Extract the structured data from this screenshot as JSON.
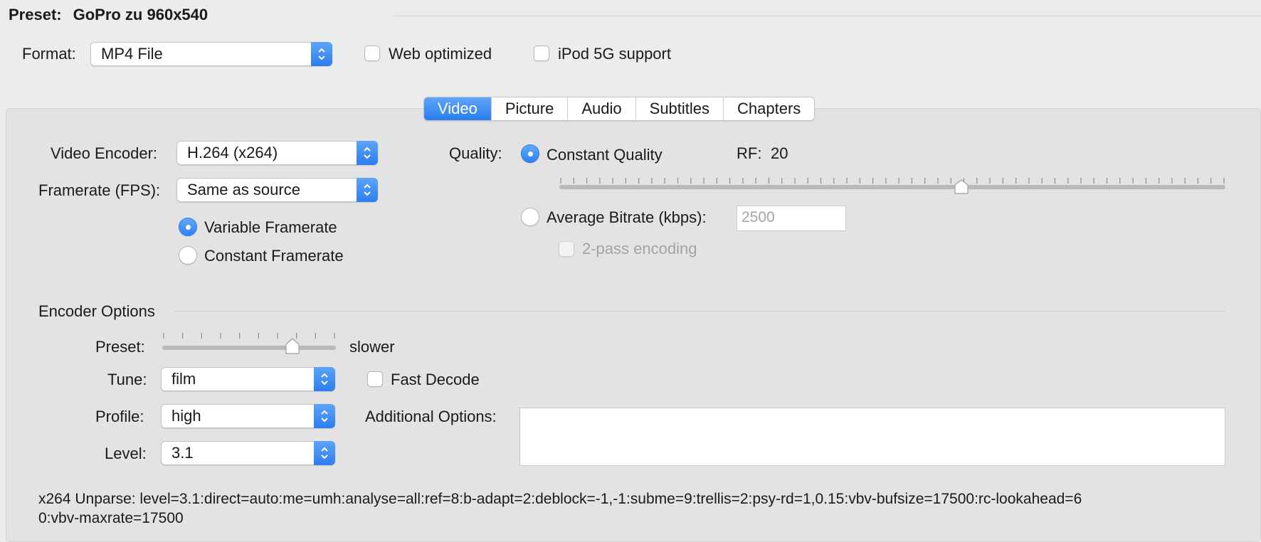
{
  "preset": {
    "label": "Preset:",
    "name": "GoPro zu 960x540"
  },
  "format": {
    "label": "Format:",
    "value": "MP4 File",
    "web_optimized_label": "Web optimized",
    "web_optimized_checked": false,
    "ipod_label": "iPod 5G support",
    "ipod_checked": false
  },
  "tabs": [
    {
      "label": "Video",
      "active": true
    },
    {
      "label": "Picture",
      "active": false
    },
    {
      "label": "Audio",
      "active": false
    },
    {
      "label": "Subtitles",
      "active": false
    },
    {
      "label": "Chapters",
      "active": false
    }
  ],
  "video": {
    "encoder_label": "Video Encoder:",
    "encoder_value": "H.264 (x264)",
    "framerate_label": "Framerate (FPS):",
    "framerate_value": "Same as source",
    "variable_framerate_label": "Variable Framerate",
    "constant_framerate_label": "Constant Framerate",
    "framerate_mode": "variable"
  },
  "quality": {
    "label": "Quality:",
    "constant_quality_label": "Constant Quality",
    "rf_label": "RF:",
    "rf_value": "20",
    "average_bitrate_label": "Average Bitrate (kbps):",
    "bitrate_value": "2500",
    "two_pass_label": "2-pass encoding",
    "mode": "constant",
    "rf_slider_fraction": 0.604
  },
  "encoder_options": {
    "title": "Encoder Options",
    "preset_label": "Preset:",
    "preset_value": "slower",
    "preset_slider_fraction": 0.75,
    "tune_label": "Tune:",
    "tune_value": "film",
    "fast_decode_label": "Fast Decode",
    "fast_decode_checked": false,
    "profile_label": "Profile:",
    "profile_value": "high",
    "additional_options_label": "Additional Options:",
    "additional_options_value": "",
    "level_label": "Level:",
    "level_value": "3.1",
    "unparse_line1": "x264 Unparse: level=3.1:direct=auto:me=umh:analyse=all:ref=8:b-adapt=2:deblock=-1,-1:subme=9:trellis=2:psy-rd=1,0.15:vbv-bufsize=17500:rc-lookahead=6",
    "unparse_line2": "0:vbv-maxrate=17500"
  }
}
